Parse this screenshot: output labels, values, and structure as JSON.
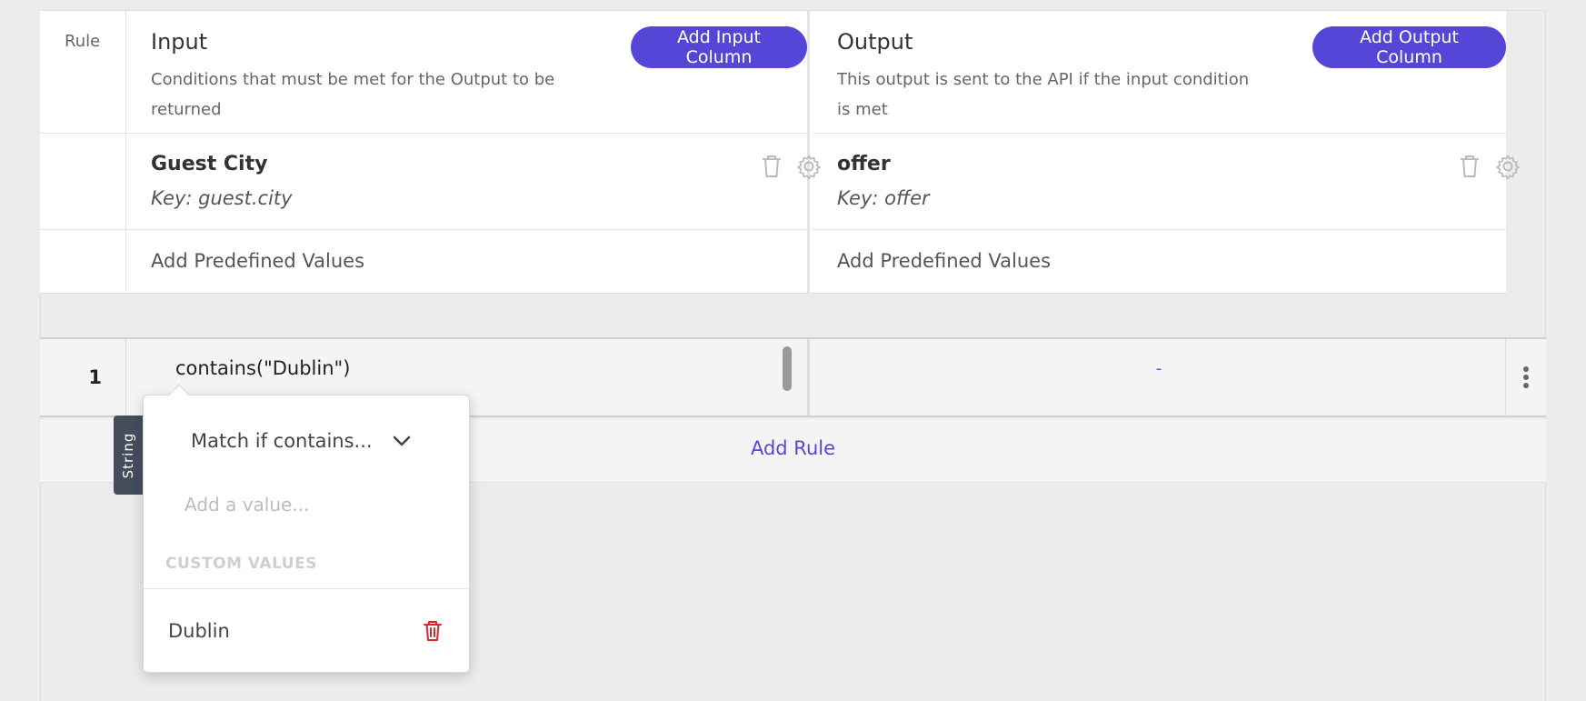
{
  "header": {
    "rule_label": "Rule",
    "input": {
      "title": "Input",
      "description": "Conditions that must be met for the Output to be returned",
      "add_button": "Add Input Column",
      "field_name": "Guest City",
      "field_key": "Key: guest.city",
      "predefined": "Add Predefined Values"
    },
    "output": {
      "title": "Output",
      "description": "This output is sent to the API if the input condition is met",
      "add_button": "Add Output Column",
      "field_name": "offer",
      "field_key": "Key: offer",
      "predefined": "Add Predefined Values"
    }
  },
  "rules": [
    {
      "number": "1",
      "input": "contains(\"Dublin\")",
      "output": "-"
    }
  ],
  "add_rule": "Add Rule",
  "type_tab": "String",
  "popover": {
    "match_select": "Match if contains...",
    "value_placeholder": "Add a value...",
    "section_label": "CUSTOM VALUES",
    "values": [
      "Dublin"
    ]
  },
  "colors": {
    "accent": "#5546d8",
    "danger": "#d9252b",
    "tab_bg": "#454d5c"
  },
  "icons": [
    "trash-icon",
    "gear-icon",
    "chevron-down-icon",
    "kebab-menu-icon"
  ]
}
